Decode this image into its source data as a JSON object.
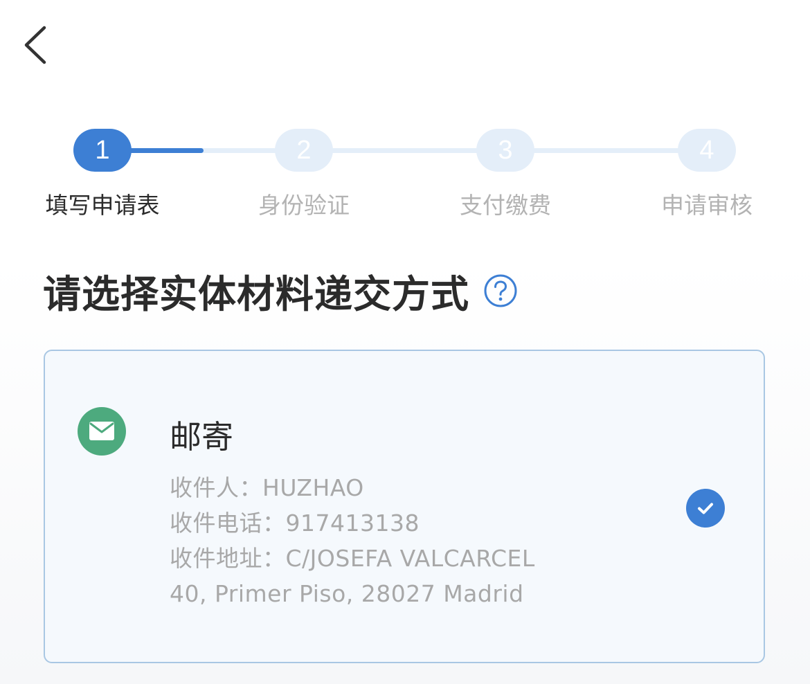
{
  "nav": {
    "back_icon": "chevron-left-icon"
  },
  "stepper": {
    "steps": [
      {
        "number": "1",
        "label": "填写申请表",
        "active": true
      },
      {
        "number": "2",
        "label": "身份验证",
        "active": false
      },
      {
        "number": "3",
        "label": "支付缴费",
        "active": false
      },
      {
        "number": "4",
        "label": "申请审核",
        "active": false
      }
    ],
    "current_step": 1,
    "active_color": "#3d7fd4",
    "inactive_color": "#e4eef9"
  },
  "heading": {
    "title": "请选择实体材料递交方式",
    "help_icon": "question-circle-icon"
  },
  "option": {
    "icon": "mail-icon",
    "icon_color": "#4daa7e",
    "title": "邮寄",
    "recipient": "收件人：HUZHAO",
    "phone": "收件电话：917413138",
    "address_line1": "收件地址：C/JOSEFA VALCARCEL",
    "address_line2": "40, Primer Piso, 28027 Madrid",
    "selected": true,
    "check_icon": "check-circle-icon",
    "check_color": "#3d7fd4"
  }
}
